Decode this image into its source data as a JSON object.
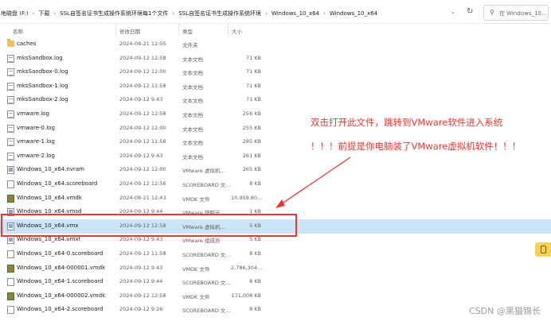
{
  "address": {
    "crumbs": [
      "地磁盘 (F:)",
      "下载",
      "SSL自签名证书生成操作系统环境每1个文件",
      "SSL自签名证书生成操作系统环境",
      "Windows_10_x64",
      "Windows_10_x64"
    ],
    "search_placeholder": "在 Windows_10..."
  },
  "columns": {
    "name": "名称",
    "date": "修改日期",
    "type": "类型",
    "size": "大小"
  },
  "files": [
    {
      "name": "caches",
      "date": "2024-08-21 12:05",
      "type": "文件夹",
      "size": "",
      "icon": "folder-icon"
    },
    {
      "name": "mksSandbox.log",
      "date": "2024-09-12 12:58",
      "type": "文本文档",
      "size": "71 KB",
      "icon": "text-file-icon"
    },
    {
      "name": "mksSandbox-0.log",
      "date": "2024-09-12 12:00",
      "type": "文本文档",
      "size": "71 KB",
      "icon": "text-file-icon"
    },
    {
      "name": "mksSandbox-1.log",
      "date": "2024-09-12 11:58",
      "type": "文本文档",
      "size": "71 KB",
      "icon": "text-file-icon"
    },
    {
      "name": "mksSandbox-2.log",
      "date": "2024-09-12 9:43",
      "type": "文本文档",
      "size": "71 KB",
      "icon": "text-file-icon"
    },
    {
      "name": "vmware.log",
      "date": "2024-09-12 12:58",
      "type": "文本文档",
      "size": "256 KB",
      "icon": "text-file-icon"
    },
    {
      "name": "vmware-0.log",
      "date": "2024-09-12 12:00",
      "type": "文本文档",
      "size": "255 KB",
      "icon": "text-file-icon"
    },
    {
      "name": "vmware-1.log",
      "date": "2024-09-12 11:58",
      "type": "文本文档",
      "size": "285 KB",
      "icon": "text-file-icon"
    },
    {
      "name": "vmware-2.log",
      "date": "2024-09-12 9:43",
      "type": "文本文档",
      "size": "261 KB",
      "icon": "text-file-icon"
    },
    {
      "name": "Windows_10_x64.nvram",
      "date": "2024-09-12 12:00",
      "type": "VMware 虚拟机...",
      "size": "265 KB",
      "icon": "vm-file-icon"
    },
    {
      "name": "Windows_10_x64.scoreboard",
      "date": "2024-09-12 12:56",
      "type": "SCOREBOARD 文...",
      "size": "8 KB",
      "icon": "blank-file-icon"
    },
    {
      "name": "Windows_10_x64.vmdk",
      "date": "2024-08-21 12:43",
      "type": "VMDK 文件",
      "size": "10,959,80...",
      "icon": "vmdk-file-icon"
    },
    {
      "name": "Windows_10_x64.vmsd",
      "date": "2024-09-12 9:44",
      "type": "VMware 快照元...",
      "size": "1 KB",
      "icon": "vm-file-icon"
    },
    {
      "name": "Windows_10_x64.vmx",
      "date": "2024-09-12 12:58",
      "type": "VMware 虚拟机...",
      "size": "5 KB",
      "icon": "vm-file-icon",
      "selected": true
    },
    {
      "name": "Windows_10_x64.vmxf",
      "date": "2024-09-12 9:43",
      "type": "VMware 组成员",
      "size": "5 KB",
      "icon": "vm-file-icon"
    },
    {
      "name": "Windows_10_x64-0.scoreboard",
      "date": "2024-09-12 11:58",
      "type": "SCOREBOARD 文...",
      "size": "8 KB",
      "icon": "blank-file-icon"
    },
    {
      "name": "Windows_10_x64-000001.vmdk",
      "date": "2024-09-12 9:43",
      "type": "VMDK 文件",
      "size": "2,786,304...",
      "icon": "vmdk-file-icon"
    },
    {
      "name": "Windows_10_x64-1.scoreboard",
      "date": "2024-09-12 9:44",
      "type": "SCOREBOARD 文...",
      "size": "8 KB",
      "icon": "blank-file-icon"
    },
    {
      "name": "Windows_10_x64-000002.vmdk",
      "date": "2024-09-12 12:58",
      "type": "VMDK 文件",
      "size": "171,008 KB",
      "icon": "vmdk-file-icon"
    },
    {
      "name": "Windows_10_x64-2.scoreboard",
      "date": "2024-09-12 9:26",
      "type": "SCOREBOARD 文...",
      "size": "8 KB",
      "icon": "blank-file-icon"
    }
  ],
  "annotations": {
    "line1": "双击打开此文件，跳转到VMware软件进入系统",
    "line2": "！！！前提是你电脑装了VMware虚拟机软件！！！",
    "color": "#e53935"
  },
  "watermark": "CSDN @黑猫锦长"
}
